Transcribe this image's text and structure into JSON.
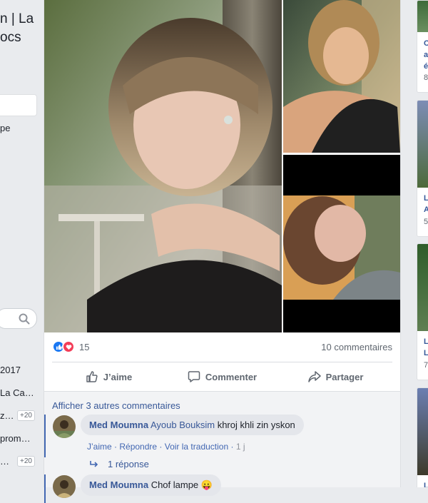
{
  "left_column": {
    "title_line1": "n | La",
    "title_line2": "ocs",
    "item_1": "pe",
    "search_icon": "search-icon",
    "list": [
      {
        "label": "2017",
        "badge": ""
      },
      {
        "label": "La Ca…",
        "badge": ""
      },
      {
        "label": "z…",
        "badge": "+20"
      },
      {
        "label": "prom…",
        "badge": ""
      },
      {
        "label": "…",
        "badge": "+20"
      }
    ]
  },
  "post": {
    "reactions": {
      "icons": [
        "like-icon",
        "love-icon"
      ],
      "count": "15",
      "comments_count": "10 commentaires"
    },
    "actions": {
      "like": "J’aime",
      "comment": "Commenter",
      "share": "Partager"
    },
    "comments": {
      "more": "Afficher 3 autres commentaires",
      "items": [
        {
          "author": "Med Moumna",
          "tagged": "Ayoub Bouksim",
          "text": "khroj khli zin yskon",
          "actions": {
            "like": "J’aime",
            "reply": "Répondre",
            "translate": "Voir la traduction",
            "time": "1 j"
          },
          "replies": "1 réponse"
        },
        {
          "author": "Med Moumna",
          "text": "Chof lampe 😛"
        }
      ]
    }
  },
  "right_column": {
    "cards": [
      {
        "title": "C",
        "line2": "a",
        "line3": "é",
        "sub": "8"
      },
      {
        "title": "L",
        "line2": "A",
        "sub": "5"
      },
      {
        "title": "L",
        "line2": "L",
        "sub": "7"
      },
      {
        "title": "L",
        "line2": "",
        "sub": ""
      }
    ]
  },
  "colors": {
    "page_bg": "#e9ebee",
    "link_blue": "#385898",
    "facebook_blue": "#4267b2",
    "love_red": "#f33e58",
    "muted_text": "#606770"
  }
}
